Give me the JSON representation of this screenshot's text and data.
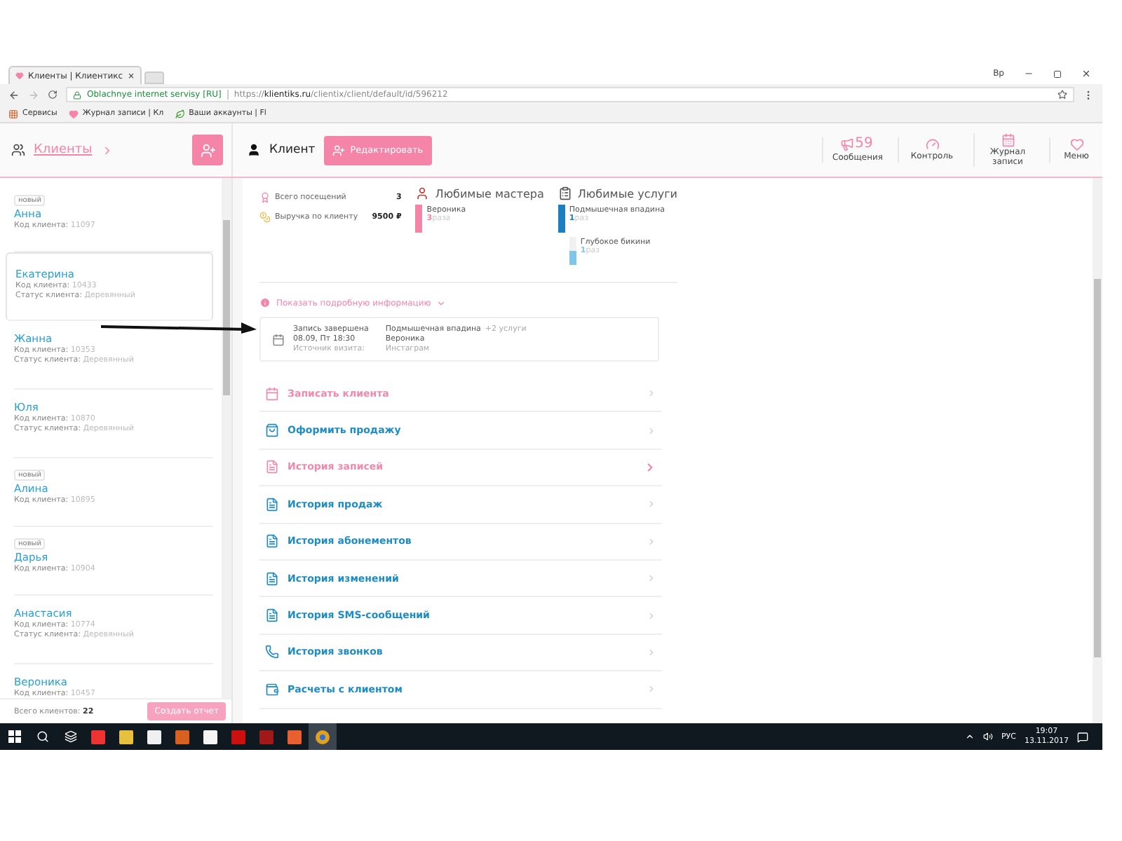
{
  "browser": {
    "tab_title": "Клиенты | Клиентикс",
    "tab_close": "×",
    "profile": "Вр",
    "site_name": "Oblachnye internet servisy [RU]",
    "url": "https://**klientiks.ru**/clientix/client/default/id/596212",
    "bookmarks": [
      {
        "kind": "apps",
        "label": "Сервисы"
      },
      {
        "kind": "heart",
        "label": "Журнал записи | Кл"
      },
      {
        "kind": "leaf",
        "label": "Ваши аккаунты | Fl"
      }
    ]
  },
  "sidebar": {
    "title": "Клиенты",
    "clients": [
      {
        "name": "Анна",
        "badge": "новый",
        "code_label": "Код клиента:",
        "code": "11097",
        "selected": false
      },
      {
        "name": "Екатерина",
        "code_label": "Код клиента:",
        "code": "10433",
        "status_label": "Статус клиента:",
        "status": "Деревянный",
        "selected": true
      },
      {
        "name": "Жанна",
        "code_label": "Код клиента:",
        "code": "10353",
        "status_label": "Статус клиента:",
        "status": "Деревянный",
        "selected": false
      },
      {
        "name": "Юля",
        "code_label": "Код клиента:",
        "code": "10870",
        "status_label": "Статус клиента:",
        "status": "Деревянный",
        "selected": false
      },
      {
        "name": "Алина",
        "badge": "новый",
        "code_label": "Код клиента:",
        "code": "10895",
        "selected": false
      },
      {
        "name": "Дарья",
        "badge": "новый",
        "code_label": "Код клиента:",
        "code": "10904",
        "selected": false
      },
      {
        "name": "Анастасия",
        "code_label": "Код клиента:",
        "code": "10774",
        "status_label": "Статус клиента:",
        "status": "Деревянный",
        "selected": false
      },
      {
        "name": "Вероника",
        "code_label": "Код клиента:",
        "code": "10457",
        "selected": false
      }
    ],
    "total_label": "Всего клиентов:",
    "total": "22",
    "report_button": "Создать отчет"
  },
  "header": {
    "title": "Клиент",
    "edit_button": "Редактировать",
    "nav": [
      {
        "kind": "messages",
        "label": "Сообщения",
        "count": "59"
      },
      {
        "kind": "control",
        "label": "Контроль"
      },
      {
        "kind": "journal",
        "label": "Журнал записи"
      },
      {
        "kind": "menu",
        "label": "Меню"
      }
    ]
  },
  "stats": [
    {
      "kind": "visits",
      "label": "Всего посещений",
      "value": "3"
    },
    {
      "kind": "revenue",
      "label": "Выручка по клиенту",
      "value": "9500 ₽"
    }
  ],
  "favorite_masters": {
    "title": "Любимые мастера",
    "items": [
      {
        "name": "Вероника",
        "count": "3",
        "unit": "раза",
        "level": 1
      }
    ]
  },
  "favorite_services": {
    "title": "Любимые услуги",
    "items": [
      {
        "name": "Подмышечная впадина",
        "count": "1",
        "unit": "раз",
        "level": 1
      },
      {
        "name": "Глубокое бикини",
        "count": "1",
        "unit": "раз",
        "level": 0.5
      }
    ]
  },
  "details_toggle": "Показать подробную информацию",
  "record": {
    "status": "Запись завершена",
    "datetime": "08.09, Пт 18:30",
    "source_label": "Источник визита:",
    "service": "Подмышечная впадина",
    "extra": "+2 услуги",
    "master": "Вероника",
    "source": "Инстаграм"
  },
  "actions": [
    {
      "kind": "calendar",
      "label": "Записать клиента",
      "color": "#f08aac",
      "selected": false
    },
    {
      "kind": "sale",
      "label": "Оформить продажу",
      "color": "#1e8bc3",
      "selected": false
    },
    {
      "kind": "history",
      "label": "История записей",
      "color": "#f08aac",
      "selected": true
    },
    {
      "kind": "history",
      "label": "История продаж",
      "color": "#1e8bc3",
      "selected": false
    },
    {
      "kind": "history",
      "label": "История абонементов",
      "color": "#1e8bc3",
      "selected": false
    },
    {
      "kind": "history",
      "label": "История изменений",
      "color": "#1e8bc3",
      "selected": false
    },
    {
      "kind": "history",
      "label": "История SMS-сообщений",
      "color": "#1e8bc3",
      "selected": false
    },
    {
      "kind": "phone",
      "label": "История звонков",
      "color": "#1e8bc3",
      "selected": false
    },
    {
      "kind": "wallet",
      "label": "Расчеты с клиентом",
      "color": "#1e8bc3",
      "selected": false
    }
  ],
  "taskbar": {
    "language": "РУС",
    "time": "19:07",
    "date": "13.11.2017"
  }
}
